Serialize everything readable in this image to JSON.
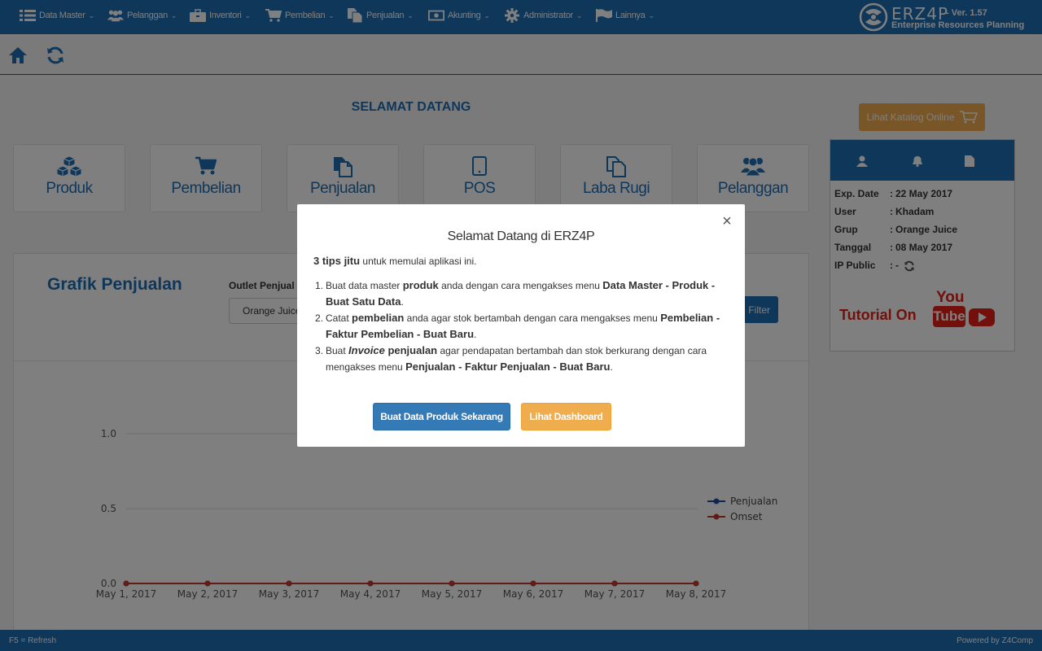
{
  "nav": {
    "items": [
      {
        "label": "Data Master",
        "icon": "list-icon"
      },
      {
        "label": "Pelanggan",
        "icon": "users-icon"
      },
      {
        "label": "Inventori",
        "icon": "briefcase-icon"
      },
      {
        "label": "Pembelian",
        "icon": "cart-icon"
      },
      {
        "label": "Penjualan",
        "icon": "copy-icon"
      },
      {
        "label": "Akunting",
        "icon": "money-icon"
      },
      {
        "label": "Administrator",
        "icon": "gear-icon"
      },
      {
        "label": "Lainnya",
        "icon": "flag-icon"
      }
    ],
    "brand": {
      "title": "ERZ4P",
      "version": "- Ver. 1.57",
      "subtitle": "Enterprise Resources Planning"
    }
  },
  "welcome_title": "SELAMAT DATANG",
  "tiles": [
    {
      "label": "Produk",
      "icon": "cubes-icon"
    },
    {
      "label": "Pembelian",
      "icon": "cart-icon"
    },
    {
      "label": "Penjualan",
      "icon": "copy-icon"
    },
    {
      "label": "POS",
      "icon": "tablet-icon"
    },
    {
      "label": "Laba Rugi",
      "icon": "documents-icon"
    },
    {
      "label": "Pelanggan",
      "icon": "users-icon"
    }
  ],
  "chart_panel": {
    "title": "Grafik Penjualan",
    "outlet_label": "Outlet Penjual",
    "outlet_value": "Orange Juice",
    "filter_label": "Filter"
  },
  "chart_data": {
    "type": "line",
    "x": [
      "May 1, 2017",
      "May 2, 2017",
      "May 3, 2017",
      "May 4, 2017",
      "May 5, 2017",
      "May 6, 2017",
      "May 7, 2017",
      "May 8, 2017"
    ],
    "series": [
      {
        "name": "Penjualan",
        "values": [
          0,
          0,
          0,
          0,
          0,
          0,
          0,
          0
        ],
        "color": "#1f4e9c"
      },
      {
        "name": "Omset",
        "values": [
          0,
          0,
          0,
          0,
          0,
          0,
          0,
          0
        ],
        "color": "#c0392b"
      }
    ],
    "yticks": [
      "0.0",
      "0.5",
      "1.0"
    ],
    "ylim": [
      0,
      1
    ],
    "legend": "right"
  },
  "catalog_button": "Lihat Katalog Online",
  "side": {
    "info": [
      {
        "key": "Exp. Date",
        "value": "22 May 2017"
      },
      {
        "key": "User",
        "value": "Khadam"
      },
      {
        "key": "Grup",
        "value": "Orange Juice"
      },
      {
        "key": "Tanggal",
        "value": "08 May 2017"
      },
      {
        "key": "IP Public",
        "value": "-"
      }
    ],
    "tutorial": "Tutorial On",
    "yt_top": "You",
    "yt_bottom": "Tube"
  },
  "modal": {
    "title": "Selamat Datang di ERZ4P",
    "intro_bold": "3 tips jitu",
    "intro_rest": "untuk memulai aplikasi ini.",
    "tips": [
      {
        "num": "1.",
        "a": "Buat data master ",
        "b": "produk",
        "c": " anda dengan cara mengakses menu ",
        "d": "Data Master - Produk - Buat Satu Data",
        "e": "."
      },
      {
        "num": "2.",
        "a": "Catat ",
        "b": "pembelian",
        "c": " anda agar stok bertambah dengan cara mengakses menu ",
        "d": "Pembelian - Faktur Pembelian - Buat Baru",
        "e": "."
      },
      {
        "num": "3.",
        "a": "Buat ",
        "bi": "Invoice",
        "b": " penjualan",
        "c": " agar pendapatan bertambah dan stok berkurang dengan cara mengakses menu ",
        "d": "Penjualan - Faktur Penjualan - Buat Baru",
        "e": "."
      }
    ],
    "primary_button": "Buat Data Produk Sekarang",
    "secondary_button": "Lihat Dashboard"
  },
  "footer": {
    "left": "F5 = Refresh",
    "right": "Powered by Z4Comp"
  }
}
